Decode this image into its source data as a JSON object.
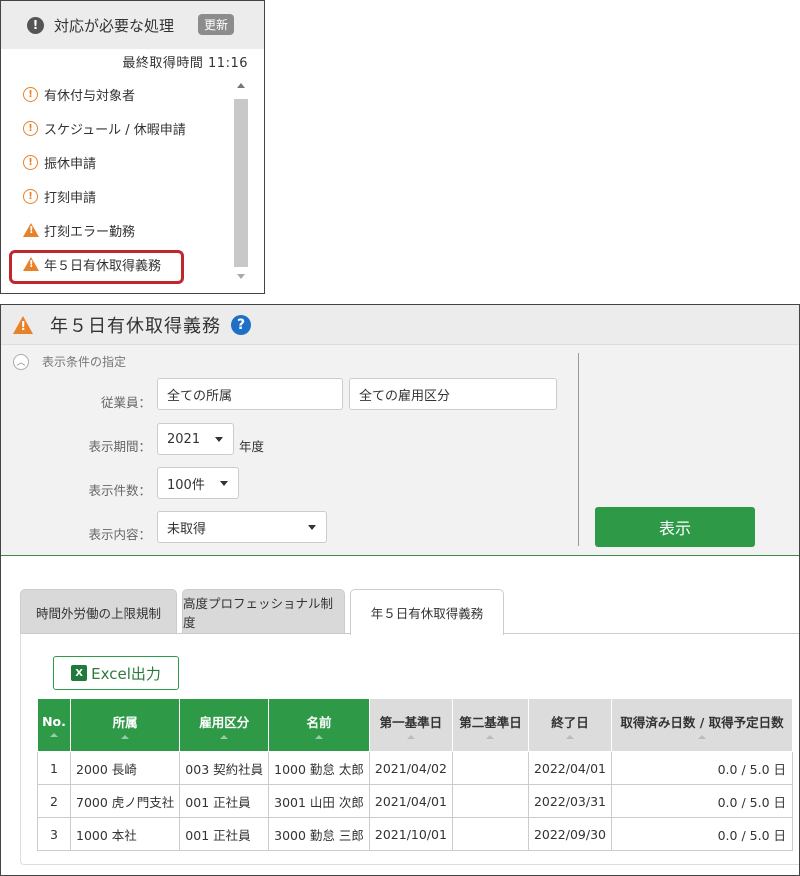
{
  "panel1": {
    "title": "対応が必要な処理",
    "refresh_label": "更新",
    "last_fetched": "最終取得時間 11:16",
    "items": [
      {
        "label": "有休付与対象者",
        "icon": "info-circle-orange"
      },
      {
        "label": "スケジュール / 休暇申請",
        "icon": "info-circle-orange"
      },
      {
        "label": "振休申請",
        "icon": "info-circle-orange"
      },
      {
        "label": "打刻申請",
        "icon": "info-circle-orange"
      },
      {
        "label": "打刻エラー勤務",
        "icon": "warning-triangle-orange"
      },
      {
        "label": "年５日有休取得義務",
        "icon": "warning-triangle-orange"
      }
    ]
  },
  "panel2": {
    "title": "年５日有休取得義務",
    "conditions_label": "表示条件の指定",
    "fields": {
      "employee_label": "従業員：",
      "department_value": "全ての所属",
      "employment_type_value": "全ての雇用区分",
      "period_label": "表示期間：",
      "period_value": "2021",
      "period_unit": "年度",
      "count_label": "表示件数：",
      "count_value": "100件",
      "content_label": "表示内容：",
      "content_value": "未取得"
    },
    "show_button": "表示",
    "tabs": [
      "時間外労働の上限規制",
      "高度プロフェッショナル制度",
      "年５日有休取得義務"
    ],
    "excel_button": "Excel出力",
    "table": {
      "headers": [
        "No.",
        "所属",
        "雇用区分",
        "名前",
        "第一基準日",
        "第二基準日",
        "終了日",
        "取得済み日数 / 取得予定日数"
      ],
      "rows": [
        [
          "1",
          "2000 長崎",
          "003 契約社員",
          "1000 勤怠 太郎",
          "2021/04/02",
          "",
          "2022/04/01",
          "0.0 / 5.0 日"
        ],
        [
          "2",
          "7000 虎ノ門支社",
          "001 正社員",
          "3001 山田 次郎",
          "2021/04/01",
          "",
          "2022/03/31",
          "0.0 / 5.0 日"
        ],
        [
          "3",
          "1000 本社",
          "001 正社員",
          "3000 勤怠 三郎",
          "2021/10/01",
          "",
          "2022/09/30",
          "0.0 / 5.0 日"
        ]
      ]
    }
  },
  "colors": {
    "accent_green": "#2e9a48",
    "warning_orange": "#e8822a",
    "highlight_red": "#c0272d",
    "help_blue": "#1e6fc6"
  }
}
